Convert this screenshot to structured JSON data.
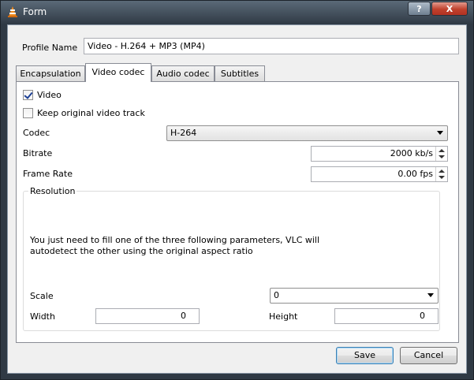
{
  "window": {
    "title": "Form",
    "help_label": "?",
    "close_label": "X"
  },
  "profile": {
    "label": "Profile Name",
    "value": "Video - H.264 + MP3 (MP4)"
  },
  "tabs": [
    {
      "label": "Encapsulation"
    },
    {
      "label": "Video codec",
      "active": true
    },
    {
      "label": "Audio codec"
    },
    {
      "label": "Subtitles"
    }
  ],
  "video": {
    "video_label": "Video",
    "video_checked": true,
    "keep_label": "Keep original video track",
    "keep_checked": false,
    "codec_label": "Codec",
    "codec_value": "H-264",
    "bitrate_label": "Bitrate",
    "bitrate_value": "2000 kb/s",
    "framerate_label": "Frame Rate",
    "framerate_value": "0.00 fps"
  },
  "resolution": {
    "title": "Resolution",
    "hint": "You just need to fill one of the three following parameters, VLC will autodetect the other using the original aspect ratio",
    "scale_label": "Scale",
    "scale_value": "0",
    "width_label": "Width",
    "width_value": "0",
    "height_label": "Height",
    "height_value": "0"
  },
  "buttons": {
    "save": "Save",
    "cancel": "Cancel"
  }
}
